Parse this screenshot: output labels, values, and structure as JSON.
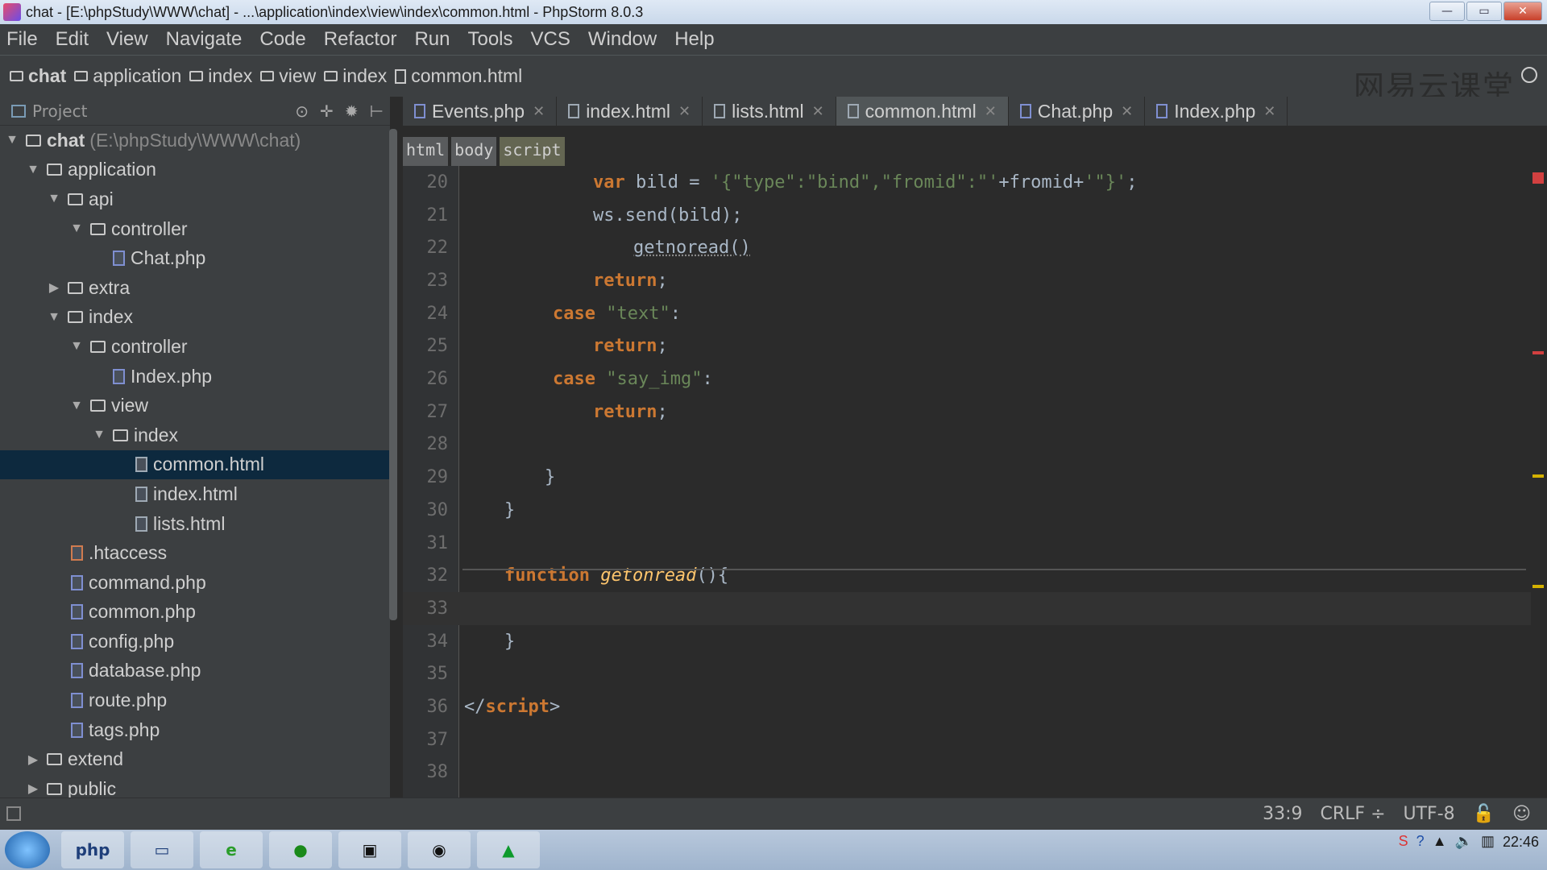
{
  "window": {
    "title": "chat - [E:\\phpStudy\\WWW\\chat] - ...\\application\\index\\view\\index\\common.html - PhpStorm 8.0.3",
    "minimize": "—",
    "restore": "▭",
    "close": "✕"
  },
  "menu": [
    "File",
    "Edit",
    "View",
    "Navigate",
    "Code",
    "Refactor",
    "Run",
    "Tools",
    "VCS",
    "Window",
    "Help"
  ],
  "breadcrumbs": [
    "chat",
    "application",
    "index",
    "view",
    "index",
    "common.html"
  ],
  "watermark": "网易云课堂",
  "project": {
    "label": "Project",
    "tree": [
      {
        "label": "chat",
        "path": "(E:\\phpStudy\\WWW\\chat)"
      },
      {
        "label": "application"
      },
      {
        "label": "api"
      },
      {
        "label": "controller"
      },
      {
        "label": "Chat.php"
      },
      {
        "label": "extra"
      },
      {
        "label": "index"
      },
      {
        "label": "controller"
      },
      {
        "label": "Index.php"
      },
      {
        "label": "view"
      },
      {
        "label": "index"
      },
      {
        "label": "common.html"
      },
      {
        "label": "index.html"
      },
      {
        "label": "lists.html"
      },
      {
        "label": ".htaccess"
      },
      {
        "label": "command.php"
      },
      {
        "label": "common.php"
      },
      {
        "label": "config.php"
      },
      {
        "label": "database.php"
      },
      {
        "label": "route.php"
      },
      {
        "label": "tags.php"
      },
      {
        "label": "extend"
      },
      {
        "label": "public"
      }
    ]
  },
  "tabs": [
    "Events.php",
    "index.html",
    "lists.html",
    "common.html",
    "Chat.php",
    "Index.php"
  ],
  "active_tab": "common.html",
  "tag_path": [
    "html",
    "body",
    "script"
  ],
  "code": {
    "line_numbers": [
      "20",
      "21",
      "22",
      "23",
      "24",
      "25",
      "26",
      "27",
      "28",
      "29",
      "30",
      "31",
      "32",
      "33",
      "34",
      "35",
      "36",
      "37",
      "38"
    ],
    "l20": {
      "kw": "var",
      "rest": " bild = ",
      "str": "'{\"type\":\"bind\",\"fromid\":\"'",
      "rest2": "+fromid+",
      "str2": "'\"}'",
      "end": ";"
    },
    "l21": "ws.send(bild);",
    "l22": "getnoread()",
    "l23_kw": "return",
    "l24_kw": "case",
    "l24_str": "\"text\"",
    "l25_kw": "return",
    "l26_kw": "case",
    "l26_str": "\"say_img\"",
    "l27_kw": "return",
    "l29": "}",
    "l30": "}",
    "l32_kw": "function",
    "l32_fn": "getonread",
    "l32_rest": "(){",
    "l34": "}",
    "l36_open": "</",
    "l36_tag": "script",
    "l36_close": ">"
  },
  "status": {
    "position": "33:9",
    "line_sep": "CRLF ÷",
    "encoding": "UTF-8"
  },
  "taskbar": {
    "clock_time": "22:46"
  }
}
